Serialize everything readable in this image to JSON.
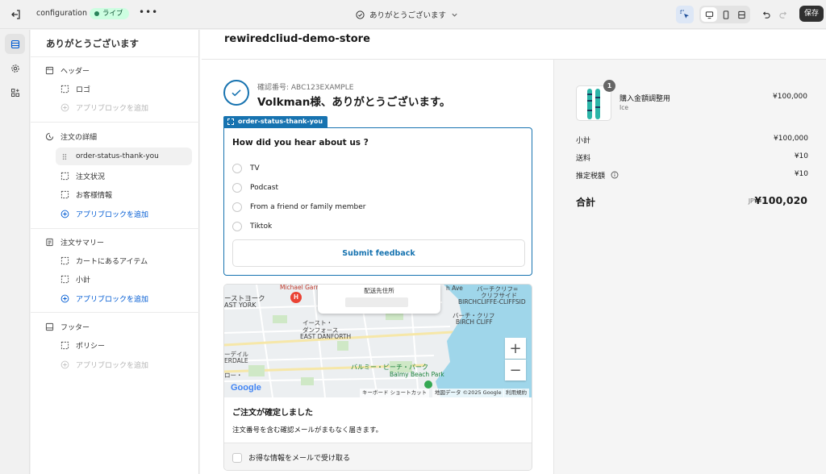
{
  "topbar": {
    "app_name": "configuration",
    "status_badge": "ライブ",
    "more_label": "•••",
    "page_selector": "ありがとうございます",
    "save_label": "保存"
  },
  "sidebar": {
    "title": "ありがとうございます",
    "sections": [
      {
        "heading": "ヘッダー",
        "items": [
          "ロゴ"
        ],
        "add_label": "アプリブロックを追加"
      },
      {
        "heading": "注文の詳細",
        "items": [
          "order-status-thank-you",
          "注文状況",
          "お客様情報"
        ],
        "add_label": "アプリブロックを追加"
      },
      {
        "heading": "注文サマリー",
        "items": [
          "カートにあるアイテム",
          "小計"
        ],
        "add_label": "アプリブロックを追加"
      },
      {
        "heading": "フッター",
        "items": [
          "ポリシー"
        ],
        "add_label": "アプリブロックを追加"
      }
    ]
  },
  "store": {
    "name": "rewiredcliud-demo-store",
    "confirmation_number": "確認番号: ABC123EXAMPLE",
    "thank_you_heading": "Volkman様、ありがとうございます。"
  },
  "extension": {
    "tag": "order-status-thank-you",
    "question": "How did you hear about us ?",
    "options": [
      "TV",
      "Podcast",
      "From a friend or family member",
      "Tiktok"
    ],
    "submit_label": "Submit feedback"
  },
  "map": {
    "popup_title": "配送先住所",
    "labels": {
      "michael": "Michael Garr",
      "east_york_jp": "ーストヨーク",
      "east_york": "AST YORK",
      "east_danforth_jp1": "イースト・",
      "east_danforth_jp2": "ダンフォース",
      "east_danforth": "EAST DANFORTH",
      "birchcliffe_jp1": "バーチクリフ=",
      "birchcliffe_jp2": "クリフサイド",
      "birchcliffe": "BIRCHCLIFFE-CLIFFSID",
      "birch_cliff_jp": "バーチ・クリフ",
      "birch_cliff": "BIRCH CLIFF",
      "balmy_jp": "バルミー・ビーチ・パーク",
      "balmy": "Balmy Beach Park",
      "avenue": "h Ave",
      "dale_jp": "ーデイル",
      "dale": "ERDALE",
      "ro": "ロー・"
    },
    "zoom_in": "+",
    "zoom_out": "−",
    "google": "Google",
    "footer_shortcuts": "キーボード ショートカット",
    "footer_data": "地図データ ©2025 Google",
    "footer_terms": "利用規約"
  },
  "confirmation": {
    "title": "ご注文が確定しました",
    "text": "注文番号を含む確認メールがまもなく届きます。"
  },
  "marketing": {
    "label": "お得な情報をメールで受け取る"
  },
  "summary": {
    "product_name": "購入金額調整用",
    "product_variant": "Ice",
    "product_price": "¥100,000",
    "quantity": "1",
    "rows": [
      {
        "label": "小計",
        "value": "¥100,000"
      },
      {
        "label": "送料",
        "value": "¥10"
      },
      {
        "label": "推定税額",
        "value": "¥10"
      }
    ],
    "total_label": "合計",
    "currency": "JPY",
    "total_value": "¥100,020"
  },
  "colors": {
    "accent": "#1773b0",
    "badge_bg": "#cdfee1",
    "badge_text": "#0c5132",
    "add_link": "#005bd3"
  }
}
